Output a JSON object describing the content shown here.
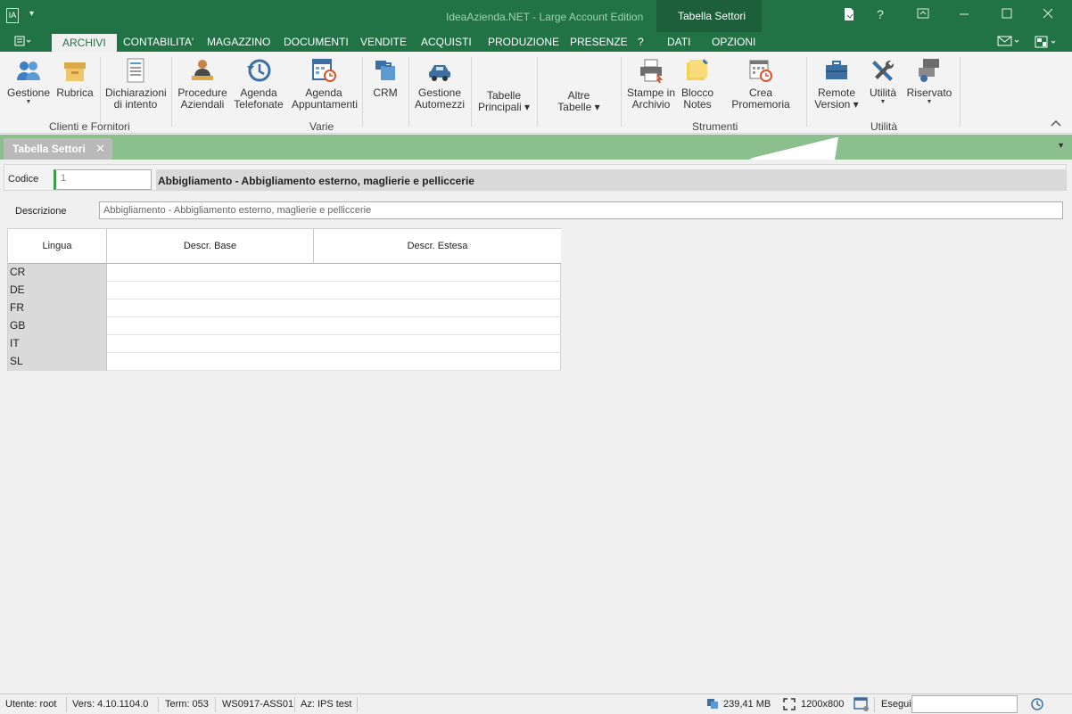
{
  "titlebar": {
    "app_icon_label": "IA",
    "title": "IdeaAzienda.NET - Large Account Edition",
    "context_tab": "Tabella Settori",
    "help": "?"
  },
  "menu_tabs": [
    "ARCHIVI",
    "CONTABILITA'",
    "MAGAZZINO",
    "DOCUMENTI",
    "VENDITE",
    "ACQUISTI",
    "PRODUZIONE",
    "PRESENZE",
    "?",
    "DATI",
    "OPZIONI"
  ],
  "ribbon": {
    "buttons": {
      "gestione": "Gestione",
      "rubrica": "Rubrica",
      "dichiarazioni": [
        "Dichiarazioni",
        "di intento"
      ],
      "procedure": [
        "Procedure",
        "Aziendali"
      ],
      "agenda_tel": [
        "Agenda",
        "Telefonate"
      ],
      "agenda_app": [
        "Agenda",
        "Appuntamenti"
      ],
      "crm": "CRM",
      "automezzi": [
        "Gestione",
        "Automezzi"
      ],
      "tabelle": [
        "Tabelle",
        "Principali ▾"
      ],
      "altre": [
        "Altre",
        "Tabelle ▾"
      ],
      "stampe": [
        "Stampe in",
        "Archivio"
      ],
      "blocco": [
        "Blocco",
        "Notes"
      ],
      "promemoria": "Crea Promemoria",
      "remote": [
        "Remote",
        "Version ▾"
      ],
      "utilita": "Utilità",
      "riservato": "Riservato"
    },
    "groups": {
      "clienti": "Clienti e Fornitori",
      "varie": "Varie",
      "strumenti": "Strumenti",
      "utilita": "Utilità"
    }
  },
  "doc_tab": {
    "label": "Tabella Settori"
  },
  "form": {
    "codice_label": "Codice",
    "codice_value": "1",
    "codice_desc": "Abbigliamento - Abbigliamento esterno, maglierie e pellicc​erie",
    "descrizione_label": "Descrizione",
    "descrizione_value": "Abbigliamento - Abbigliamento esterno, maglierie e pellicc​erie"
  },
  "grid": {
    "headers": [
      "Lingua",
      "Descr. Base",
      "Descr. Estesa"
    ],
    "rows": [
      {
        "lingua": "CR",
        "base": "",
        "estesa": ""
      },
      {
        "lingua": "DE",
        "base": "",
        "estesa": ""
      },
      {
        "lingua": "FR",
        "base": "",
        "estesa": ""
      },
      {
        "lingua": "GB",
        "base": "",
        "estesa": ""
      },
      {
        "lingua": "IT",
        "base": "",
        "estesa": ""
      },
      {
        "lingua": "SL",
        "base": "",
        "estesa": ""
      }
    ]
  },
  "status": {
    "utente": "Utente: root",
    "versione": "Vers: 4.10.1104.0",
    "term": "Term: 053",
    "ws": "WS0917-ASS01",
    "az": "Az: IPS test",
    "memoria": "239,41 MB",
    "risoluzione": "1200x800",
    "esegui": "Esegui"
  },
  "colors": {
    "accent": "#217346",
    "context": "#1c5f3a",
    "doctab_bar": "#8bbf8d"
  }
}
